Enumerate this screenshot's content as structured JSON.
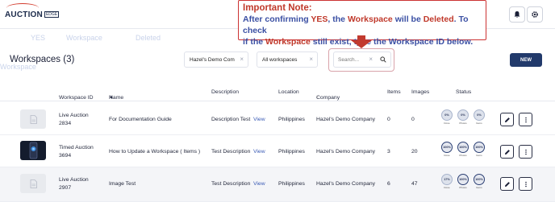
{
  "app": {
    "logo_main": "AUCTION",
    "logo_sub": "EDGE"
  },
  "note": {
    "title": "Important Note:",
    "line1_a": "After confirming ",
    "line1_yes": "YES",
    "line1_b": ", the ",
    "line1_ws": "Workspace",
    "line1_c": " will be ",
    "line1_del": "Deleted",
    "line1_d": ". To check",
    "line2_a": "if the ",
    "line2_ws": "Workspace",
    "line2_b": " still exist, type the Workspace ID below."
  },
  "ghost_nav": [
    "YES",
    "Workspace",
    "Deleted",
    "Workspace"
  ],
  "page": {
    "title": "Workspaces (3)"
  },
  "filters": {
    "company": "Hazel's Demo Com",
    "workspaces": "All workspaces",
    "search_placeholder": "Search..."
  },
  "new_button": "NEW",
  "table": {
    "headers": {
      "workspace_id": "Workspace ID",
      "name": "Name",
      "description": "Description",
      "location": "Location",
      "company": "Company",
      "items": "Items",
      "images": "Images",
      "status": "Status"
    },
    "status_labels": [
      "Done",
      "Photos",
      "Items"
    ],
    "rows": [
      {
        "type": "Live Auction",
        "id": "2834",
        "name": "For Documentation Guide",
        "description": "Description Test",
        "view": "View",
        "location": "Philippines",
        "company": "Hazel's Demo Company",
        "items": "0",
        "images": "0",
        "status": [
          "0%",
          "0%",
          "0%"
        ]
      },
      {
        "type": "Timed Auction",
        "id": "3694",
        "name": "How to Update a Workspace ( Items )",
        "description": "Test Description",
        "view": "View",
        "location": "Philippines",
        "company": "Hazel's Demo Company",
        "items": "3",
        "images": "20",
        "status": [
          "100%",
          "100%",
          "100%"
        ]
      },
      {
        "type": "Live Auction",
        "id": "2907",
        "name": "Image Test",
        "description": "Test Description",
        "view": "View",
        "location": "Philippines",
        "company": "Hazel's Demo Company",
        "items": "6",
        "images": "47",
        "status": [
          "17%",
          "100%",
          "100%"
        ]
      }
    ]
  },
  "colors": {
    "primary": "#223a6b",
    "note_red": "#c0392b",
    "note_blue": "#3a4fa3",
    "link": "#3a5bb5"
  }
}
